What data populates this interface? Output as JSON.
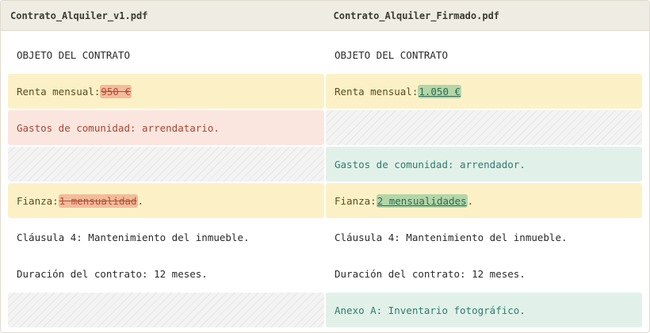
{
  "files": {
    "left": "Contrato_Alquiler_v1.pdf",
    "right": "Contrato_Alquiler_Firmado.pdf"
  },
  "colors": {
    "modified_bg": "#fcf1c6",
    "deleted_bg": "#fbe6df",
    "added_bg": "#e1f1ea"
  },
  "rows": [
    {
      "left": {
        "text": "OBJETO DEL CONTRATO"
      },
      "right": {
        "text": "OBJETO DEL CONTRATO"
      }
    },
    {
      "left": {
        "prefix": "Renta mensual:",
        "change": "950 €",
        "suffix": ""
      },
      "right": {
        "prefix": "Renta mensual:",
        "change": "1.050 €",
        "suffix": ""
      }
    },
    {
      "left": {
        "text": "Gastos de comunidad: arrendatario."
      },
      "right": {
        "text": ""
      }
    },
    {
      "left": {
        "text": ""
      },
      "right": {
        "text": "Gastos de comunidad: arrendador."
      }
    },
    {
      "left": {
        "prefix": "Fianza:",
        "change": "1 mensualidad",
        "suffix": "."
      },
      "right": {
        "prefix": "Fianza:",
        "change": "2 mensualidades",
        "suffix": "."
      }
    },
    {
      "left": {
        "text": "Cláusula 4: Mantenimiento del inmueble."
      },
      "right": {
        "text": "Cláusula 4: Mantenimiento del inmueble."
      }
    },
    {
      "left": {
        "text": "Duración del contrato: 12 meses."
      },
      "right": {
        "text": "Duración del contrato: 12 meses."
      }
    },
    {
      "left": {
        "text": ""
      },
      "right": {
        "text": "Anexo A: Inventario fotográfico."
      }
    }
  ]
}
